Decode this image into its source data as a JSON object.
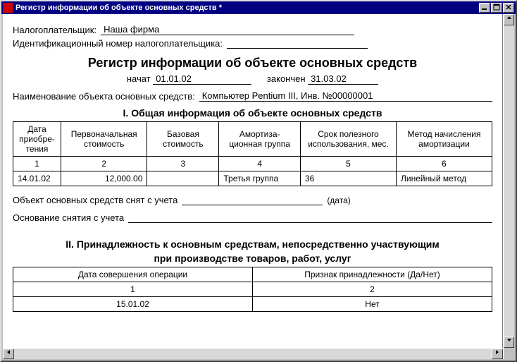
{
  "window": {
    "title": "Регистр информации об объекте основных средств  *"
  },
  "form": {
    "taxpayer_label": "Налогоплательщик:",
    "taxpayer_value": "Наша фирма",
    "tin_label": "Идентификационный номер налогоплательщика:",
    "tin_value": "",
    "main_title": "Регистр информации об объекте основных средств",
    "start_label": "начат",
    "start_date": "01.01.02",
    "end_label": "закончен",
    "end_date": "31.03.02",
    "object_label": "Наименование объекта основных средств:",
    "object_value": "Компьютер Pentium III, Инв. №00000001",
    "section1_title": "I. Общая информация об объекте основных средств",
    "table1": {
      "headers": [
        "Дата приобре-\nтения",
        "Первоначальная стоимость",
        "Базовая стоимость",
        "Амортиза-\nционная группа",
        "Срок полезного использования, мес.",
        "Метод начисления амортизации"
      ],
      "nums": [
        "1",
        "2",
        "3",
        "4",
        "5",
        "6"
      ],
      "row": [
        "14.01.02",
        "12,000.00",
        "",
        "Третья группа",
        "36",
        "Линейный метод"
      ]
    },
    "removed_label": "Объект основных средств снят с учета",
    "removed_value": "",
    "date_caption": "(дата)",
    "basis_label": "Основание снятия с учета",
    "basis_value": "",
    "section2_title_line1": "II. Принадлежность к основным средствам, непосредственно участвующим",
    "section2_title_line2": "при производстве товаров, работ, услуг",
    "table2": {
      "headers": [
        "Дата совершения операции",
        "Признак принадлежности (Да/Нет)"
      ],
      "nums": [
        "1",
        "2"
      ],
      "row": [
        "15.01.02",
        "Нет"
      ]
    }
  }
}
